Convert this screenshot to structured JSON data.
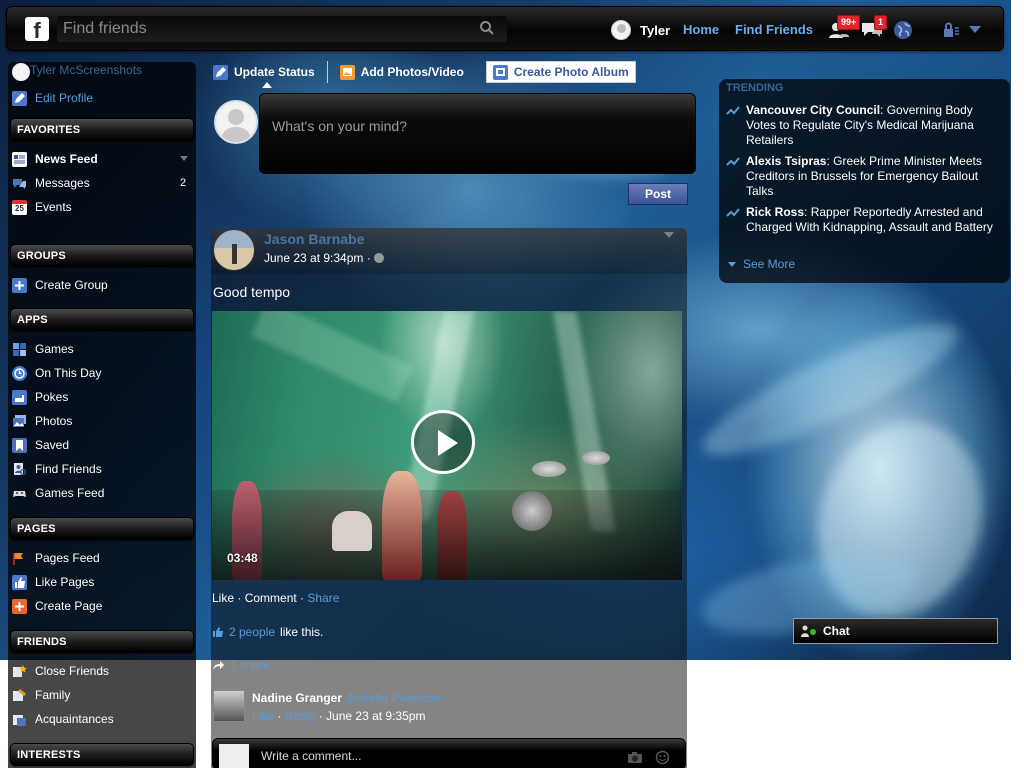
{
  "topbar": {
    "logo": "f",
    "search_placeholder": "Find friends",
    "user_name": "Tyler",
    "links": [
      "Home",
      "Find Friends"
    ],
    "friend_requests_badge": "99+",
    "messages_badge": "1"
  },
  "sidebar": {
    "profile_name": "Tyler McScreenshots",
    "edit_profile": "Edit Profile",
    "favorites_header": "FAVORITES",
    "favorites": [
      {
        "label": "News Feed",
        "count": ""
      },
      {
        "label": "Messages",
        "count": "2"
      },
      {
        "label": "Events",
        "count": ""
      }
    ],
    "events_icon_text": "25",
    "groups_header": "GROUPS",
    "groups": [
      {
        "label": "Create Group"
      }
    ],
    "apps_header": "APPS",
    "apps": [
      {
        "label": "Games"
      },
      {
        "label": "On This Day"
      },
      {
        "label": "Pokes"
      },
      {
        "label": "Photos"
      },
      {
        "label": "Saved"
      },
      {
        "label": "Find Friends"
      },
      {
        "label": "Games Feed"
      }
    ],
    "pages_header": "PAGES",
    "pages": [
      {
        "label": "Pages Feed"
      },
      {
        "label": "Like Pages"
      },
      {
        "label": "Create Page"
      }
    ],
    "friends_header": "FRIENDS",
    "friends": [
      {
        "label": "Close Friends"
      },
      {
        "label": "Family"
      },
      {
        "label": "Acquaintances"
      }
    ],
    "interests_header": "INTERESTS"
  },
  "composer": {
    "tabs": [
      {
        "label": "Update Status"
      },
      {
        "label": "Add Photos/Video"
      },
      {
        "label": "Create Photo Album"
      }
    ],
    "placeholder": "What's on your mind?",
    "post_label": "Post"
  },
  "story": {
    "author": "Jason Barnabe",
    "time": "June 23 at 9:34pm ·",
    "text": "Good tempo",
    "video_duration": "03:48",
    "actions": {
      "like": "Like",
      "comment": "Comment",
      "share": "Share"
    },
    "likes_link": "2 people",
    "likes_suffix": "like this.",
    "shares": "1 share",
    "comment": {
      "name": "Nadine Granger",
      "tagged": "Jennifer Paterson",
      "like": "Like",
      "reply": "Reply",
      "time": "June 23 at 9:35pm"
    },
    "write_comment_placeholder": "Write a comment..."
  },
  "trending": {
    "title": "TRENDING",
    "items": [
      {
        "topic": "Vancouver City Council",
        "text": ": Governing Body Votes to Regulate City's Medical Marijuana Retailers"
      },
      {
        "topic": "Alexis Tsipras",
        "text": ": Greek Prime Minister Meets Creditors in Brussels for Emergency Bailout Talks"
      },
      {
        "topic": "Rick Ross",
        "text": ": Rapper Reportedly Arrested and Charged With Kidnapping, Assault and Battery"
      }
    ],
    "see_more": "See More"
  },
  "chat": {
    "label": "Chat"
  },
  "colors": {
    "link_blue": "#5b9bd6",
    "nav_link_blue": "#6aaeea",
    "post_button": "#4a63a5",
    "badge_red": "#e0262b"
  }
}
